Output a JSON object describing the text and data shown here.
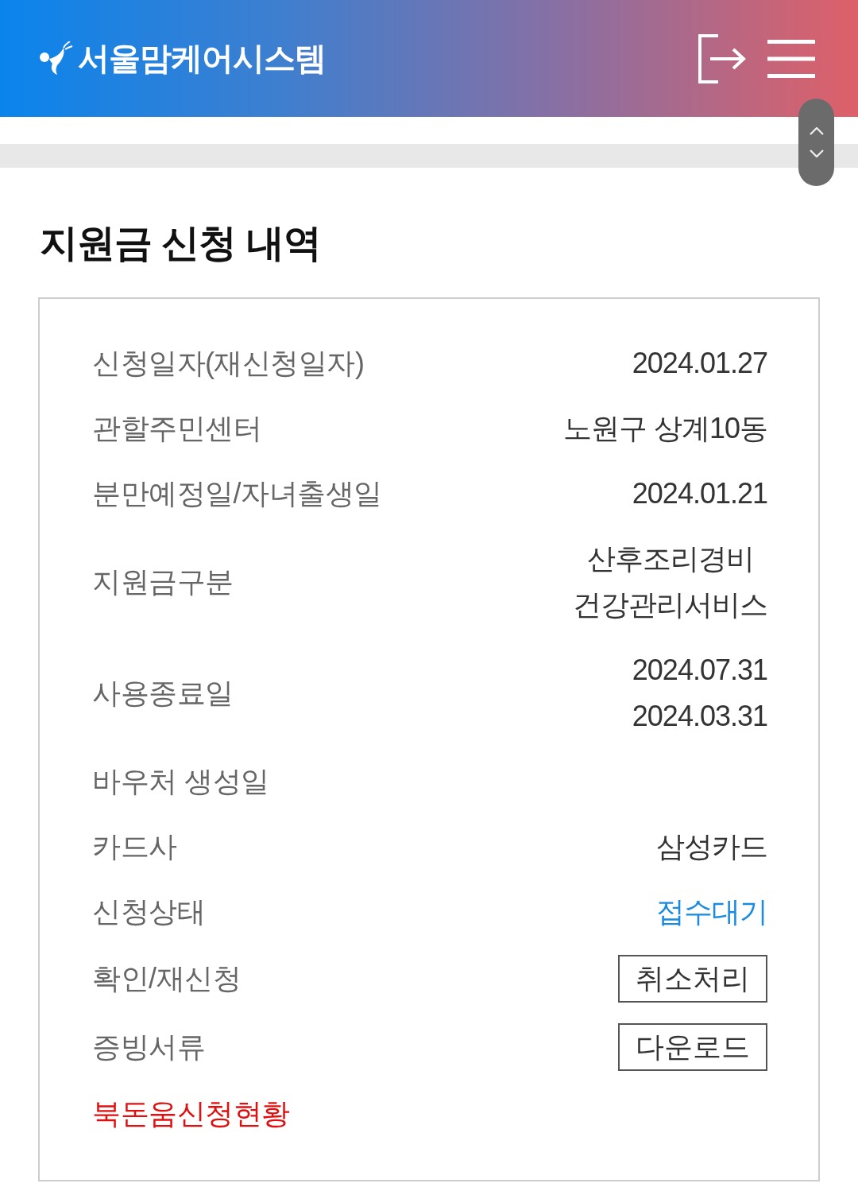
{
  "header": {
    "logo_text": "서울맘케어시스템"
  },
  "page_title": "지원금 신청 내역",
  "details": [
    {
      "kind": "text",
      "label": "신청일자(재신청일자)",
      "values": [
        "2024.01.27"
      ]
    },
    {
      "kind": "text",
      "label": "관할주민센터",
      "values": [
        "노원구 상계10동"
      ]
    },
    {
      "kind": "text",
      "label": "분만예정일/자녀출생일",
      "values": [
        "2024.01.21"
      ]
    },
    {
      "kind": "text",
      "label": "지원금구분",
      "values": [
        "산후조리경비",
        "건강관리서비스"
      ]
    },
    {
      "kind": "text",
      "label": "사용종료일",
      "values": [
        "2024.07.31",
        "2024.03.31"
      ]
    },
    {
      "kind": "text",
      "label": "바우처 생성일"
    },
    {
      "kind": "text",
      "label": "카드사",
      "values": [
        "삼성카드"
      ]
    },
    {
      "kind": "status",
      "label": "신청상태",
      "values": [
        "접수대기"
      ]
    },
    {
      "kind": "button",
      "label": "확인/재신청",
      "button": "취소처리"
    },
    {
      "kind": "button",
      "label": "증빙서류",
      "button": "다운로드"
    }
  ],
  "link": "북돈움신청현황"
}
